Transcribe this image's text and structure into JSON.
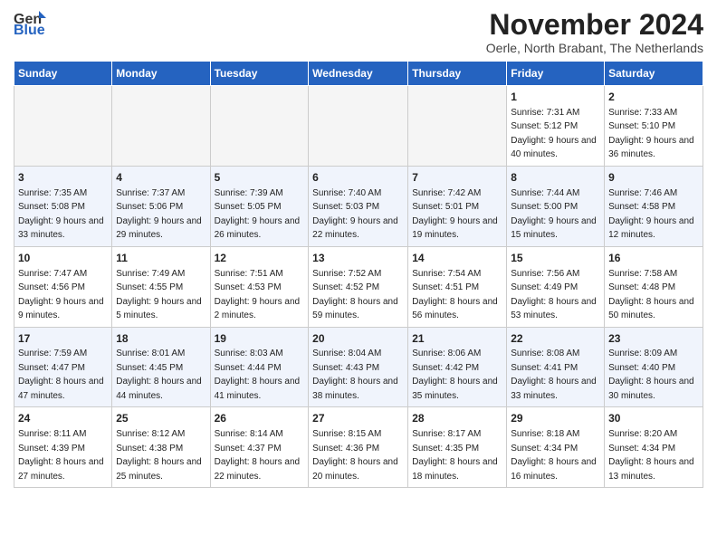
{
  "header": {
    "logo_general": "General",
    "logo_blue": "Blue",
    "month_title": "November 2024",
    "location": "Oerle, North Brabant, The Netherlands"
  },
  "weekdays": [
    "Sunday",
    "Monday",
    "Tuesday",
    "Wednesday",
    "Thursday",
    "Friday",
    "Saturday"
  ],
  "weeks": [
    [
      {
        "day": "",
        "info": ""
      },
      {
        "day": "",
        "info": ""
      },
      {
        "day": "",
        "info": ""
      },
      {
        "day": "",
        "info": ""
      },
      {
        "day": "",
        "info": ""
      },
      {
        "day": "1",
        "info": "Sunrise: 7:31 AM\nSunset: 5:12 PM\nDaylight: 9 hours and 40 minutes."
      },
      {
        "day": "2",
        "info": "Sunrise: 7:33 AM\nSunset: 5:10 PM\nDaylight: 9 hours and 36 minutes."
      }
    ],
    [
      {
        "day": "3",
        "info": "Sunrise: 7:35 AM\nSunset: 5:08 PM\nDaylight: 9 hours and 33 minutes."
      },
      {
        "day": "4",
        "info": "Sunrise: 7:37 AM\nSunset: 5:06 PM\nDaylight: 9 hours and 29 minutes."
      },
      {
        "day": "5",
        "info": "Sunrise: 7:39 AM\nSunset: 5:05 PM\nDaylight: 9 hours and 26 minutes."
      },
      {
        "day": "6",
        "info": "Sunrise: 7:40 AM\nSunset: 5:03 PM\nDaylight: 9 hours and 22 minutes."
      },
      {
        "day": "7",
        "info": "Sunrise: 7:42 AM\nSunset: 5:01 PM\nDaylight: 9 hours and 19 minutes."
      },
      {
        "day": "8",
        "info": "Sunrise: 7:44 AM\nSunset: 5:00 PM\nDaylight: 9 hours and 15 minutes."
      },
      {
        "day": "9",
        "info": "Sunrise: 7:46 AM\nSunset: 4:58 PM\nDaylight: 9 hours and 12 minutes."
      }
    ],
    [
      {
        "day": "10",
        "info": "Sunrise: 7:47 AM\nSunset: 4:56 PM\nDaylight: 9 hours and 9 minutes."
      },
      {
        "day": "11",
        "info": "Sunrise: 7:49 AM\nSunset: 4:55 PM\nDaylight: 9 hours and 5 minutes."
      },
      {
        "day": "12",
        "info": "Sunrise: 7:51 AM\nSunset: 4:53 PM\nDaylight: 9 hours and 2 minutes."
      },
      {
        "day": "13",
        "info": "Sunrise: 7:52 AM\nSunset: 4:52 PM\nDaylight: 8 hours and 59 minutes."
      },
      {
        "day": "14",
        "info": "Sunrise: 7:54 AM\nSunset: 4:51 PM\nDaylight: 8 hours and 56 minutes."
      },
      {
        "day": "15",
        "info": "Sunrise: 7:56 AM\nSunset: 4:49 PM\nDaylight: 8 hours and 53 minutes."
      },
      {
        "day": "16",
        "info": "Sunrise: 7:58 AM\nSunset: 4:48 PM\nDaylight: 8 hours and 50 minutes."
      }
    ],
    [
      {
        "day": "17",
        "info": "Sunrise: 7:59 AM\nSunset: 4:47 PM\nDaylight: 8 hours and 47 minutes."
      },
      {
        "day": "18",
        "info": "Sunrise: 8:01 AM\nSunset: 4:45 PM\nDaylight: 8 hours and 44 minutes."
      },
      {
        "day": "19",
        "info": "Sunrise: 8:03 AM\nSunset: 4:44 PM\nDaylight: 8 hours and 41 minutes."
      },
      {
        "day": "20",
        "info": "Sunrise: 8:04 AM\nSunset: 4:43 PM\nDaylight: 8 hours and 38 minutes."
      },
      {
        "day": "21",
        "info": "Sunrise: 8:06 AM\nSunset: 4:42 PM\nDaylight: 8 hours and 35 minutes."
      },
      {
        "day": "22",
        "info": "Sunrise: 8:08 AM\nSunset: 4:41 PM\nDaylight: 8 hours and 33 minutes."
      },
      {
        "day": "23",
        "info": "Sunrise: 8:09 AM\nSunset: 4:40 PM\nDaylight: 8 hours and 30 minutes."
      }
    ],
    [
      {
        "day": "24",
        "info": "Sunrise: 8:11 AM\nSunset: 4:39 PM\nDaylight: 8 hours and 27 minutes."
      },
      {
        "day": "25",
        "info": "Sunrise: 8:12 AM\nSunset: 4:38 PM\nDaylight: 8 hours and 25 minutes."
      },
      {
        "day": "26",
        "info": "Sunrise: 8:14 AM\nSunset: 4:37 PM\nDaylight: 8 hours and 22 minutes."
      },
      {
        "day": "27",
        "info": "Sunrise: 8:15 AM\nSunset: 4:36 PM\nDaylight: 8 hours and 20 minutes."
      },
      {
        "day": "28",
        "info": "Sunrise: 8:17 AM\nSunset: 4:35 PM\nDaylight: 8 hours and 18 minutes."
      },
      {
        "day": "29",
        "info": "Sunrise: 8:18 AM\nSunset: 4:34 PM\nDaylight: 8 hours and 16 minutes."
      },
      {
        "day": "30",
        "info": "Sunrise: 8:20 AM\nSunset: 4:34 PM\nDaylight: 8 hours and 13 minutes."
      }
    ]
  ]
}
